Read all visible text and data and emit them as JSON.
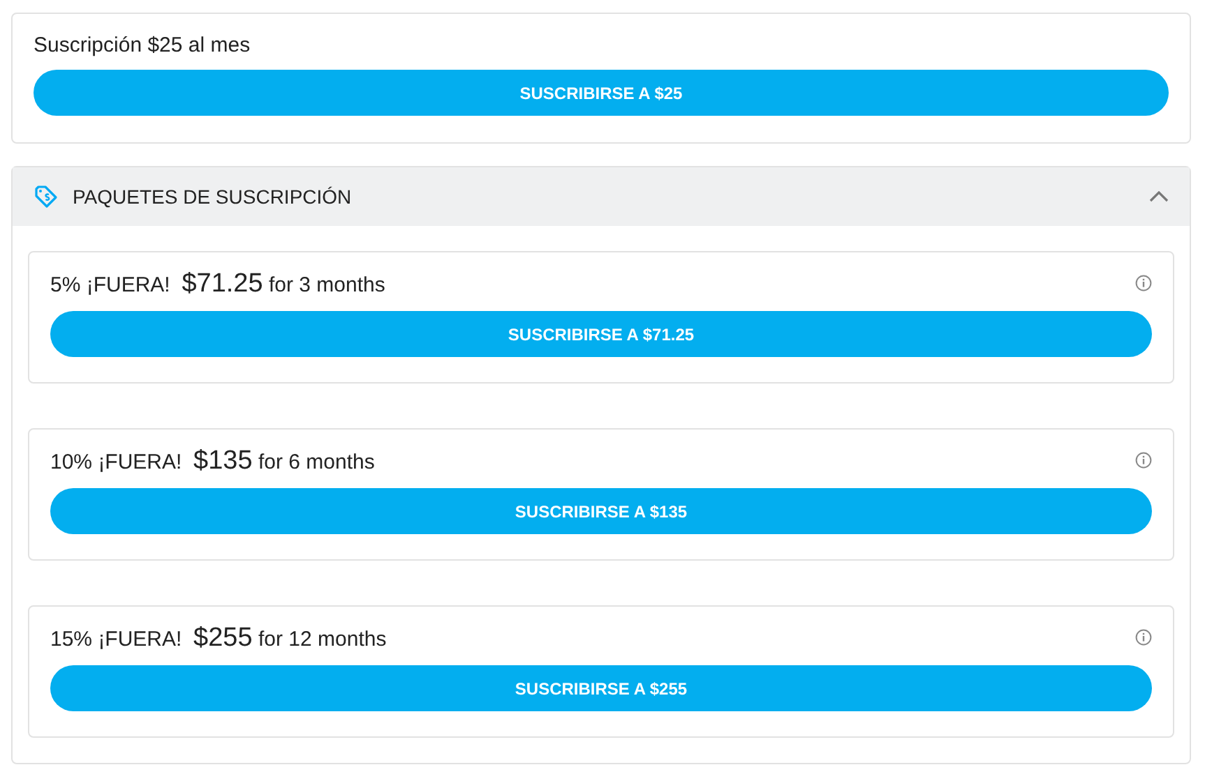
{
  "subscription": {
    "title": "Suscripción $25 al mes",
    "button": "SUSCRIBIRSE A $25"
  },
  "packages_section": {
    "title": "PAQUETES DE SUSCRIPCIÓN",
    "expanded": true,
    "packages": [
      {
        "discount": "5% ¡FUERA!",
        "price": "$71.25",
        "term": "for 3 months",
        "button": "SUSCRIBIRSE A $71.25"
      },
      {
        "discount": "10% ¡FUERA!",
        "price": "$135",
        "term": "for 6 months",
        "button": "SUSCRIBIRSE A $135"
      },
      {
        "discount": "15% ¡FUERA!",
        "price": "$255",
        "term": "for 12 months",
        "button": "SUSCRIBIRSE A $255"
      }
    ]
  }
}
